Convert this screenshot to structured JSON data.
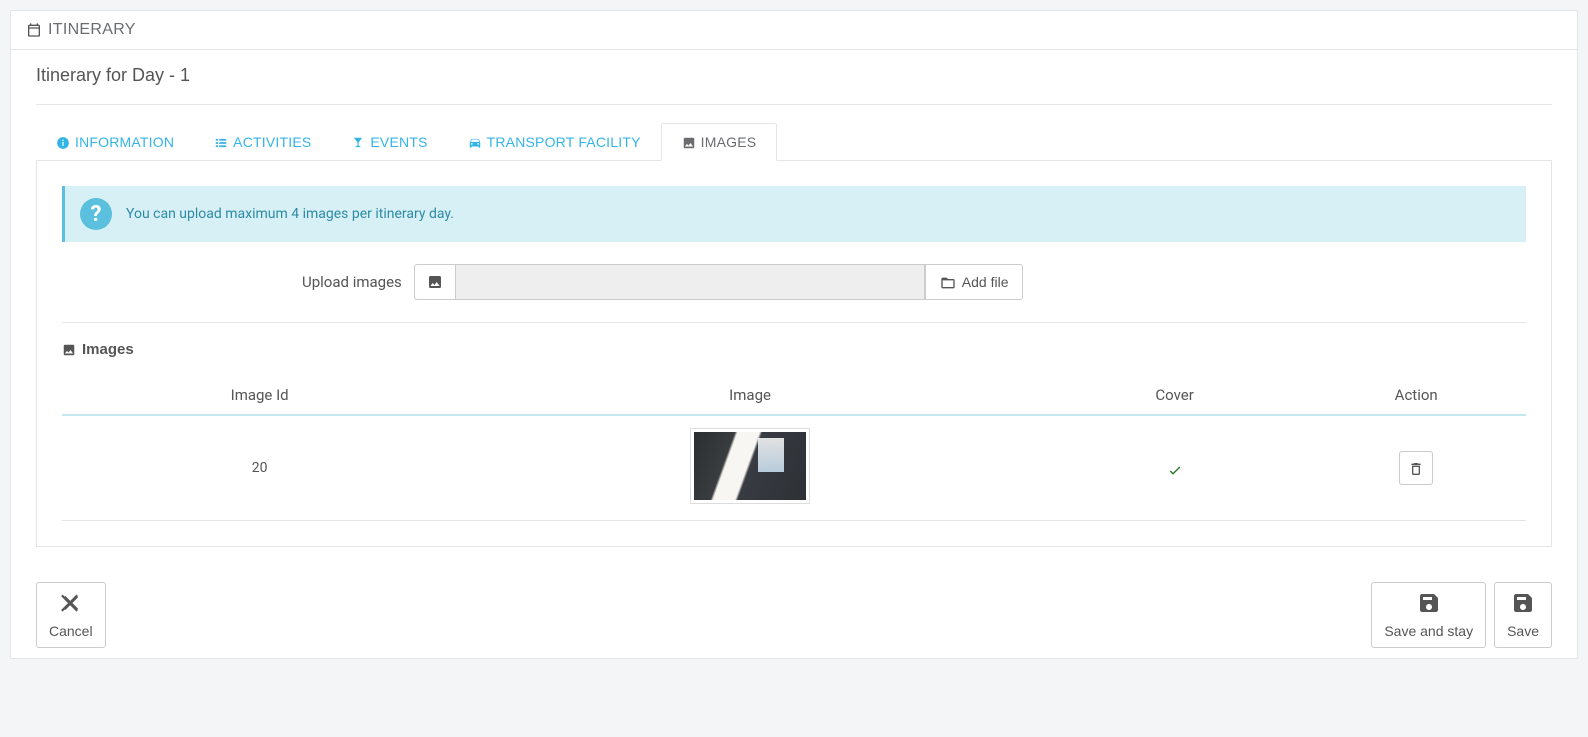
{
  "panel": {
    "title": "ITINERARY"
  },
  "subtitle": "Itinerary for Day - 1",
  "tabs": {
    "information": "INFORMATION",
    "activities": "ACTIVITIES",
    "events": "EVENTS",
    "transport": "TRANSPORT FACILITY",
    "images": "IMAGES"
  },
  "alert": {
    "message": "You can upload maximum 4 images per itinerary day."
  },
  "upload": {
    "label": "Upload images",
    "add_file": "Add file"
  },
  "images_section": {
    "title": "Images",
    "headers": {
      "id": "Image Id",
      "image": "Image",
      "cover": "Cover",
      "action": "Action"
    },
    "rows": [
      {
        "id": "20",
        "cover": true
      }
    ]
  },
  "footer": {
    "cancel": "Cancel",
    "save_stay": "Save and stay",
    "save": "Save"
  }
}
